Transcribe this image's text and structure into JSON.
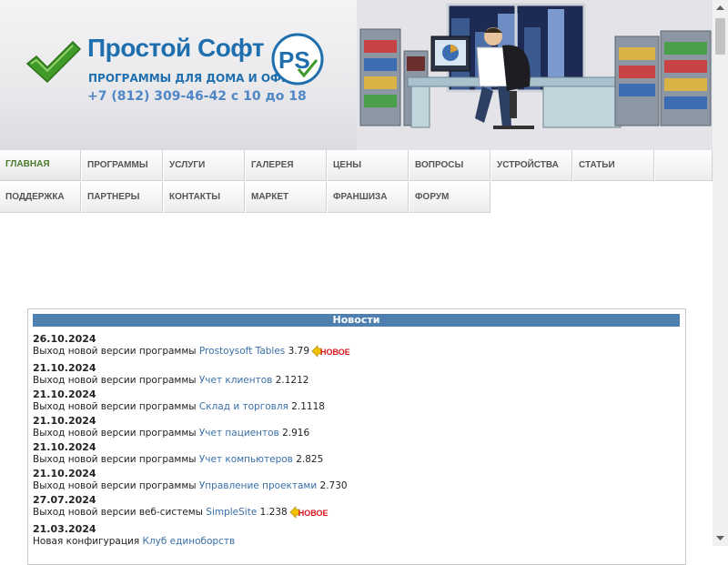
{
  "brand": {
    "name": "Простой Софт",
    "tagline": "ПРОГРАММЫ ДЛЯ ДОМА И ОФИСА",
    "phone": "+7 (812) 309-46-42 с 10 до 18",
    "ps_logo_text": "PS",
    "accent_color": "#1f6fae"
  },
  "nav": {
    "row1": [
      {
        "label": "ГЛАВНАЯ",
        "active": true
      },
      {
        "label": "ПРОГРАММЫ"
      },
      {
        "label": "УСЛУГИ"
      },
      {
        "label": "ГАЛЕРЕЯ"
      },
      {
        "label": "ЦЕНЫ"
      },
      {
        "label": "ВОПРОСЫ"
      },
      {
        "label": "УСТРОЙСТВА"
      },
      {
        "label": "СТАТЬИ"
      }
    ],
    "row2": [
      {
        "label": "ПОДДЕРЖКА"
      },
      {
        "label": "ПАРТНЕРЫ"
      },
      {
        "label": "КОНТАКТЫ"
      },
      {
        "label": "МАРКЕТ"
      },
      {
        "label": "ФРАНШИЗА"
      },
      {
        "label": "ФОРУМ"
      }
    ]
  },
  "news": {
    "title": "Новости",
    "badge_label": "НОВОЕ",
    "items": [
      {
        "date": "26.10.2024",
        "prefix": "Выход новой версии программы ",
        "link": "Prostoysoft Tables",
        "version": " 3.79",
        "is_new": true
      },
      {
        "date": "21.10.2024",
        "prefix": "Выход новой версии программы ",
        "link": "Учет клиентов",
        "version": " 2.1212"
      },
      {
        "date": "21.10.2024",
        "prefix": "Выход новой версии программы ",
        "link": "Склад и торговля",
        "version": " 2.1118"
      },
      {
        "date": "21.10.2024",
        "prefix": "Выход новой версии программы ",
        "link": "Учет пациентов",
        "version": " 2.916"
      },
      {
        "date": "21.10.2024",
        "prefix": "Выход новой версии программы ",
        "link": "Учет компьютеров",
        "version": " 2.825"
      },
      {
        "date": "21.10.2024",
        "prefix": "Выход новой версии программы ",
        "link": "Управление проектами",
        "version": " 2.730"
      },
      {
        "date": "27.07.2024",
        "prefix": "Выход новой версии веб-системы ",
        "link": "SimpleSite",
        "version": " 1.238",
        "is_new": true
      },
      {
        "date": "21.03.2024",
        "prefix": "Новая конфигурация ",
        "link": "Клуб единоборств",
        "version": ""
      }
    ]
  }
}
